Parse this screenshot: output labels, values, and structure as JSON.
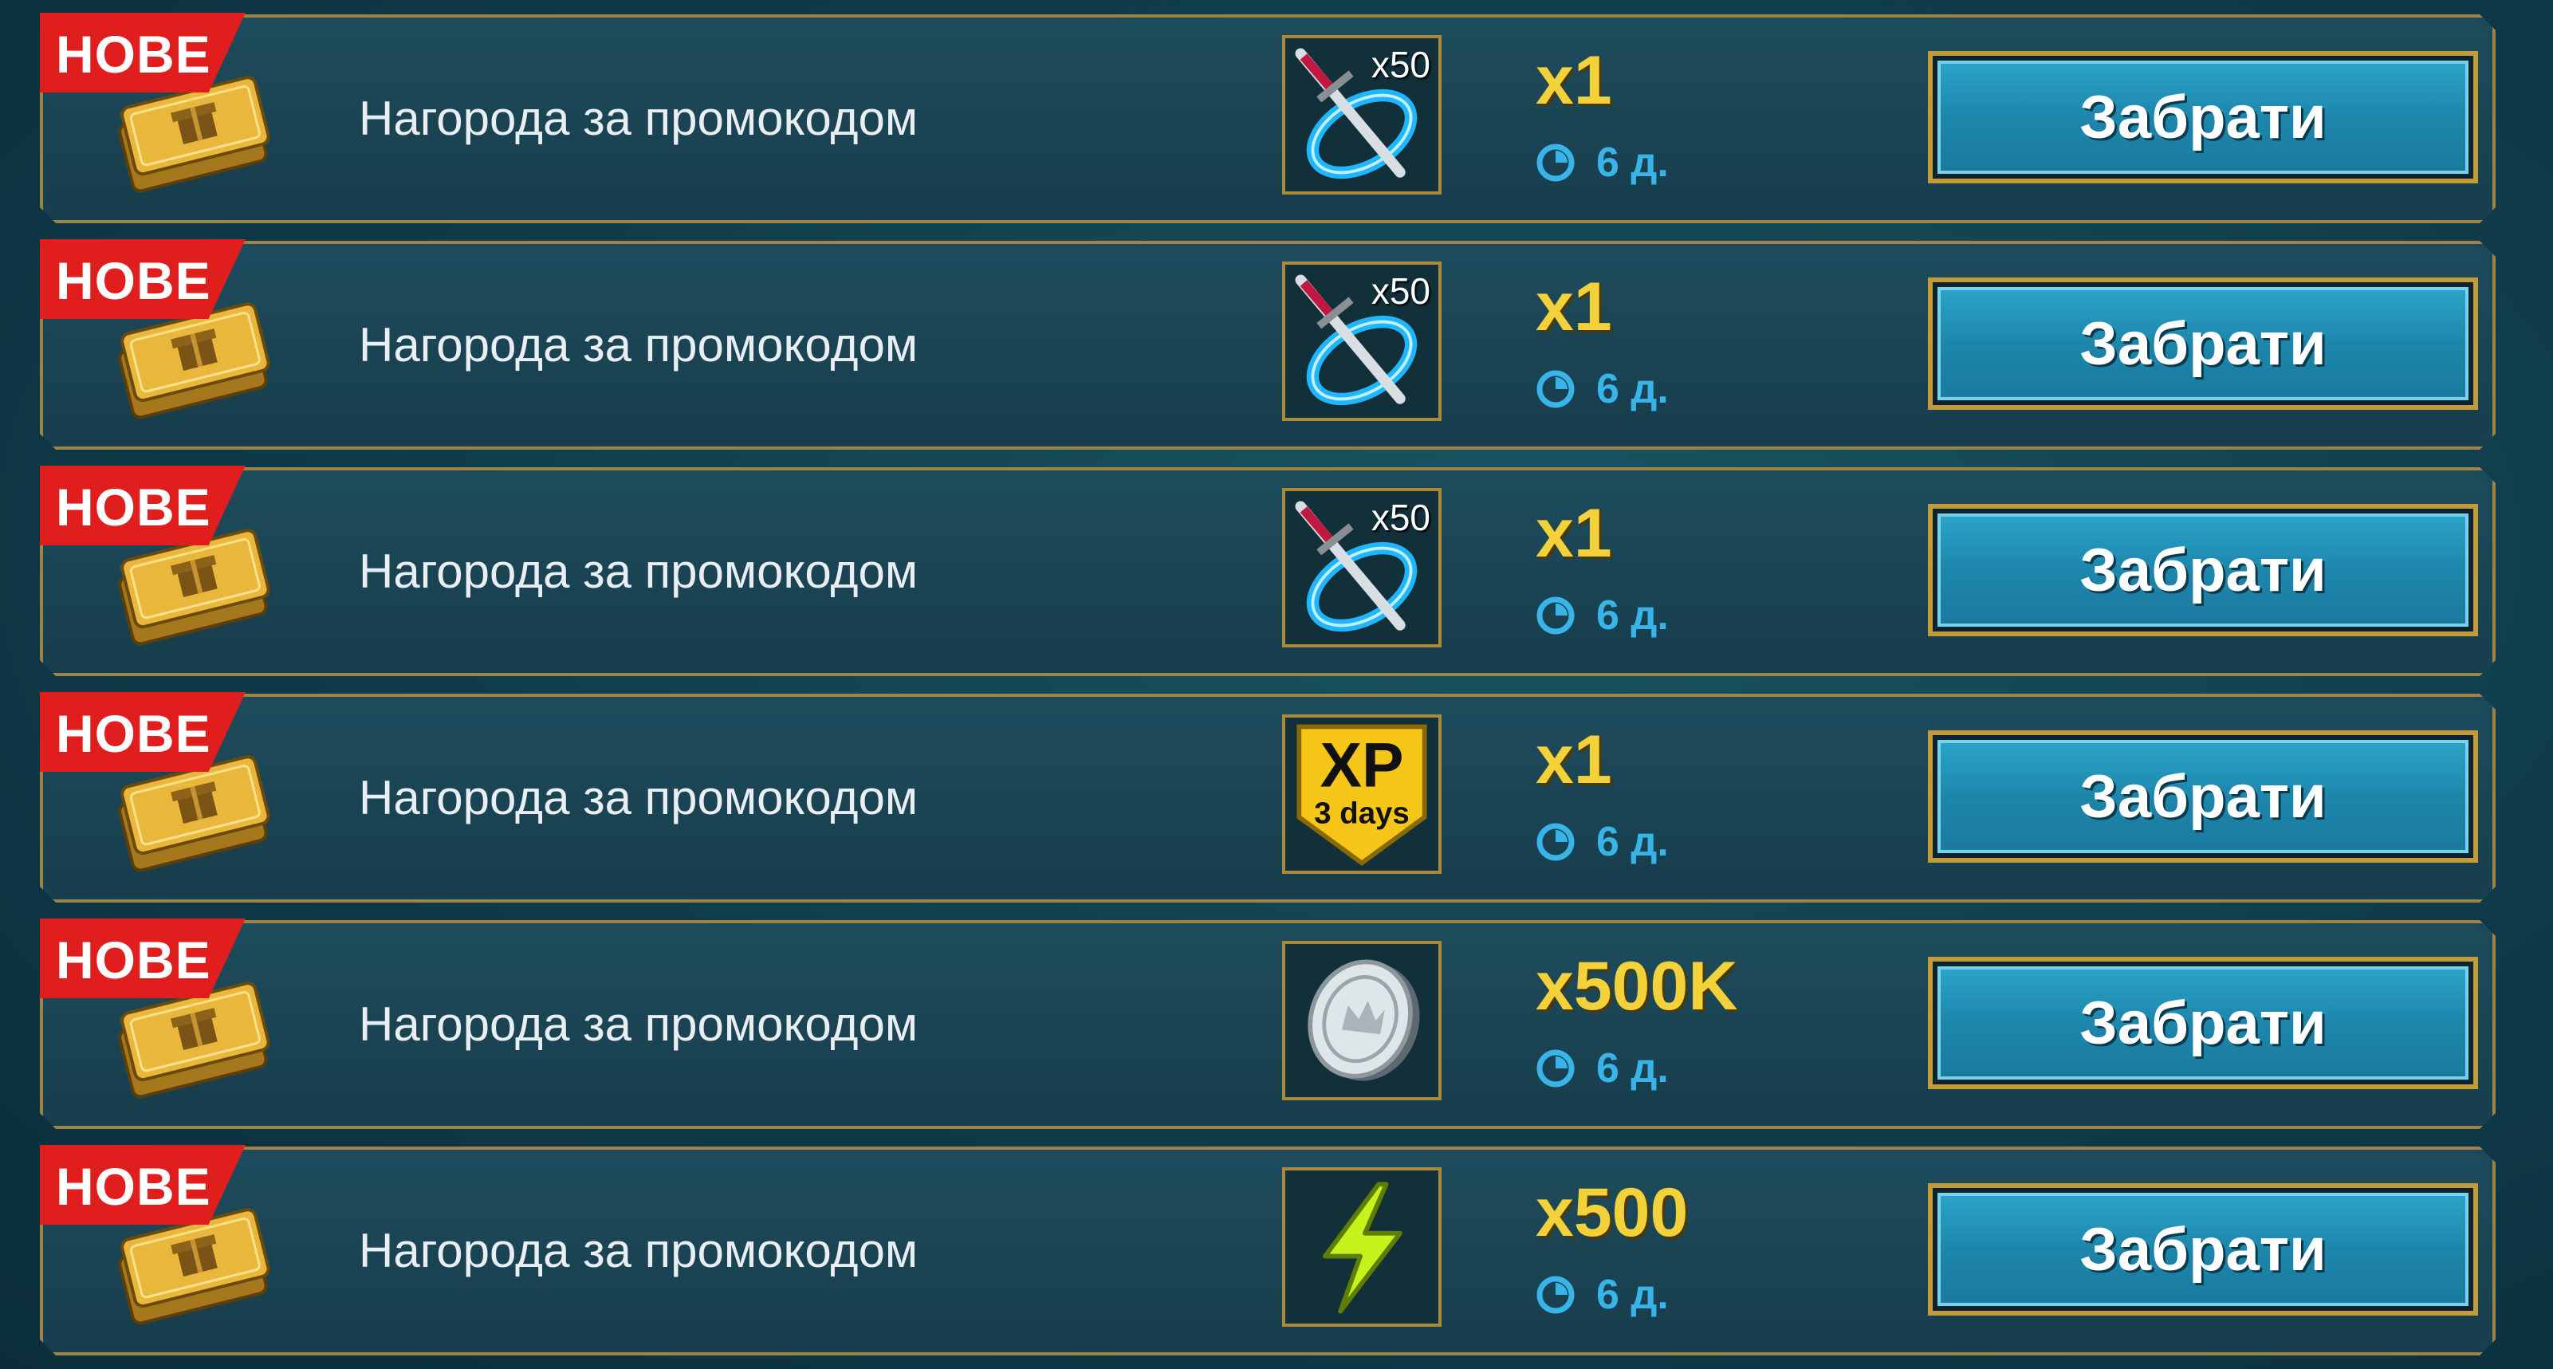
{
  "rewards": [
    {
      "badge": "НОВЕ",
      "label": "Нагорода за промокодом",
      "item_icon": "dagger-portal-icon",
      "item_count": "x50",
      "quantity": "x1",
      "timer": "6 д.",
      "button": "Забрати"
    },
    {
      "badge": "НОВЕ",
      "label": "Нагорода за промокодом",
      "item_icon": "dagger-portal-icon",
      "item_count": "x50",
      "quantity": "x1",
      "timer": "6 д.",
      "button": "Забрати"
    },
    {
      "badge": "НОВЕ",
      "label": "Нагорода за промокодом",
      "item_icon": "dagger-portal-icon",
      "item_count": "x50",
      "quantity": "x1",
      "timer": "6 д.",
      "button": "Забрати"
    },
    {
      "badge": "НОВЕ",
      "label": "Нагорода за промокодом",
      "item_icon": "xp-boost-icon",
      "item_text_top": "XP",
      "item_text_bottom": "3 days",
      "quantity": "x1",
      "timer": "6 д.",
      "button": "Забрати"
    },
    {
      "badge": "НОВЕ",
      "label": "Нагорода за промокодом",
      "item_icon": "silver-coin-icon",
      "quantity": "x500K",
      "timer": "6 д.",
      "button": "Забрати"
    },
    {
      "badge": "НОВЕ",
      "label": "Нагорода за промокодом",
      "item_icon": "energy-bolt-icon",
      "quantity": "x500",
      "timer": "6 д.",
      "button": "Забрати"
    }
  ],
  "colors": {
    "badge_red": "#e01e1e",
    "quantity_gold": "#f3d13b",
    "timer_blue": "#39b4e8",
    "button_blue": "#1d86ab",
    "frame_gold": "#9c8447"
  }
}
